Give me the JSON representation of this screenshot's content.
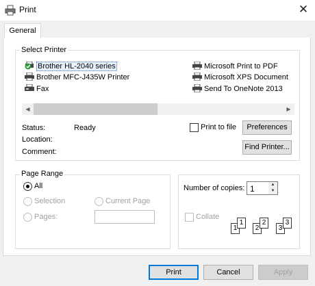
{
  "window": {
    "title": "Print",
    "close_glyph": "✕"
  },
  "tabs": [
    {
      "label": "General"
    }
  ],
  "select_printer": {
    "legend": "Select Printer",
    "printers": [
      {
        "name": "Brother HL-2040 series",
        "icon": "default-printer-icon",
        "selected": true
      },
      {
        "name": "Brother MFC-J435W Printer",
        "icon": "printer-icon"
      },
      {
        "name": "Fax",
        "icon": "fax-icon"
      },
      {
        "name": "Microsoft Print to PDF",
        "icon": "printer-icon"
      },
      {
        "name": "Microsoft XPS Document",
        "icon": "printer-icon"
      },
      {
        "name": "Send To OneNote 2013",
        "icon": "printer-icon"
      }
    ],
    "status_label": "Status:",
    "status_value": "Ready",
    "location_label": "Location:",
    "comment_label": "Comment:",
    "print_to_file_label": "Print to file",
    "preferences_label": "Preferences",
    "find_printer_label": "Find Printer..."
  },
  "page_range": {
    "legend": "Page Range",
    "all_label": "All",
    "selection_label": "Selection",
    "current_page_label": "Current Page",
    "pages_label": "Pages:"
  },
  "copies": {
    "number_label": "Number of copies:",
    "value": "1",
    "collate_label": "Collate",
    "collate_pages": [
      "1",
      "1",
      "2",
      "2",
      "3",
      "3"
    ]
  },
  "footer": {
    "print_label": "Print",
    "cancel_label": "Cancel",
    "apply_label": "Apply"
  },
  "colors": {
    "accent": "#0078d7",
    "selection_bg": "#e8f2fc"
  }
}
